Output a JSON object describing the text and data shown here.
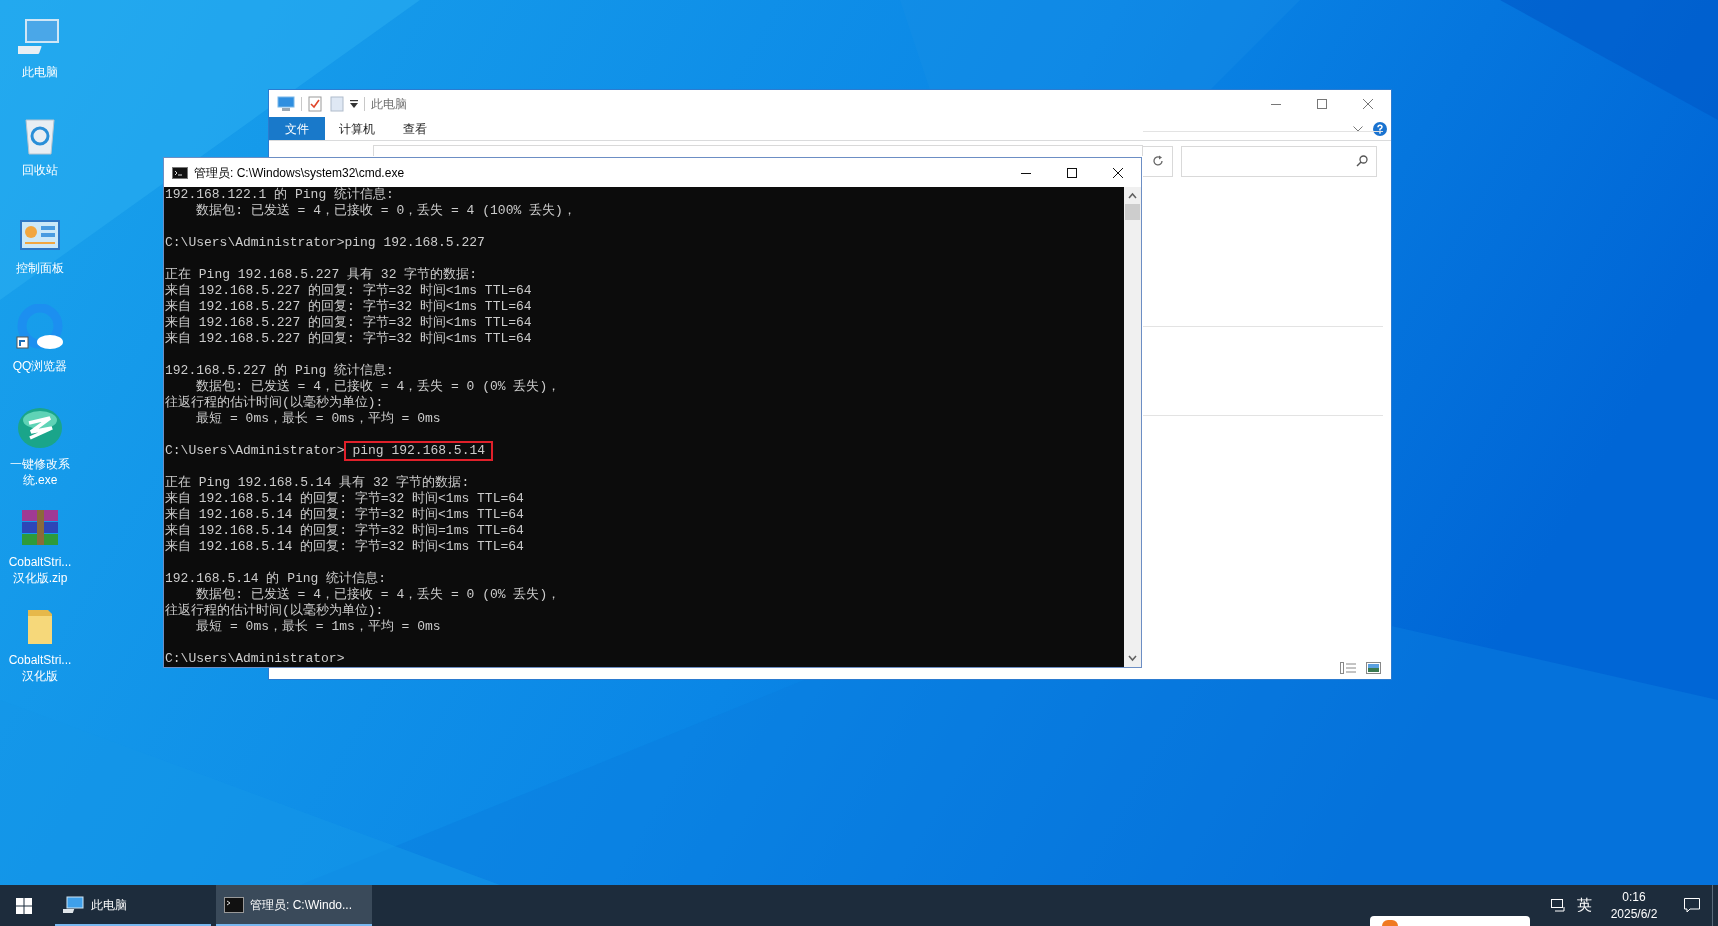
{
  "desktop_icons": [
    {
      "kind": "computer",
      "label_lines": [
        "此电脑"
      ]
    },
    {
      "kind": "recycle-bin",
      "label_lines": [
        "回收站"
      ]
    },
    {
      "kind": "control-panel",
      "label_lines": [
        "控制面板"
      ]
    },
    {
      "kind": "browser",
      "label_lines": [
        "QQ浏览器"
      ]
    },
    {
      "kind": "app",
      "label_lines": [
        "一键修改系",
        "统.exe"
      ]
    },
    {
      "kind": "archive",
      "label_lines": [
        "CobaltStri...",
        "汉化版.zip"
      ]
    },
    {
      "kind": "folder",
      "label_lines": [
        "CobaltStri...",
        "汉化版"
      ]
    }
  ],
  "explorer": {
    "title": "此电脑",
    "ribbon_tabs": [
      {
        "label": "文件",
        "selected": true
      },
      {
        "label": "计算机",
        "selected": false
      },
      {
        "label": "查看",
        "selected": false
      }
    ]
  },
  "console": {
    "title": "管理员: C:\\Windows\\system32\\cmd.exe",
    "lines": [
      {
        "kind": "output",
        "text": "192.168.122.1 的 Ping 统计信息:"
      },
      {
        "kind": "output",
        "text": "    数据包: 已发送 = 4，已接收 = 0，丢失 = 4 (100% 丢失)，"
      },
      {
        "kind": "blank"
      },
      {
        "kind": "command",
        "prompt": "C:\\Users\\Administrator>",
        "command": "ping 192.168.5.227",
        "highlighted": false
      },
      {
        "kind": "blank"
      },
      {
        "kind": "output",
        "text": "正在 Ping 192.168.5.227 具有 32 字节的数据:"
      },
      {
        "kind": "output",
        "text": "来自 192.168.5.227 的回复: 字节=32 时间<1ms TTL=64"
      },
      {
        "kind": "output",
        "text": "来自 192.168.5.227 的回复: 字节=32 时间<1ms TTL=64"
      },
      {
        "kind": "output",
        "text": "来自 192.168.5.227 的回复: 字节=32 时间<1ms TTL=64"
      },
      {
        "kind": "output",
        "text": "来自 192.168.5.227 的回复: 字节=32 时间<1ms TTL=64"
      },
      {
        "kind": "blank"
      },
      {
        "kind": "output",
        "text": "192.168.5.227 的 Ping 统计信息:"
      },
      {
        "kind": "output",
        "text": "    数据包: 已发送 = 4，已接收 = 4，丢失 = 0 (0% 丢失)，"
      },
      {
        "kind": "output",
        "text": "往返行程的估计时间(以毫秒为单位):"
      },
      {
        "kind": "output",
        "text": "    最短 = 0ms，最长 = 0ms，平均 = 0ms"
      },
      {
        "kind": "blank"
      },
      {
        "kind": "command",
        "prompt": "C:\\Users\\Administrator>",
        "command": "ping 192.168.5.14",
        "highlighted": true
      },
      {
        "kind": "blank"
      },
      {
        "kind": "output",
        "text": "正在 Ping 192.168.5.14 具有 32 字节的数据:"
      },
      {
        "kind": "output",
        "text": "来自 192.168.5.14 的回复: 字节=32 时间<1ms TTL=64"
      },
      {
        "kind": "output",
        "text": "来自 192.168.5.14 的回复: 字节=32 时间<1ms TTL=64"
      },
      {
        "kind": "output",
        "text": "来自 192.168.5.14 的回复: 字节=32 时间=1ms TTL=64"
      },
      {
        "kind": "output",
        "text": "来自 192.168.5.14 的回复: 字节=32 时间<1ms TTL=64"
      },
      {
        "kind": "blank"
      },
      {
        "kind": "output",
        "text": "192.168.5.14 的 Ping 统计信息:"
      },
      {
        "kind": "output",
        "text": "    数据包: 已发送 = 4，已接收 = 4，丢失 = 0 (0% 丢失)，"
      },
      {
        "kind": "output",
        "text": "往返行程的估计时间(以毫秒为单位):"
      },
      {
        "kind": "output",
        "text": "    最短 = 0ms，最长 = 1ms，平均 = 0ms"
      },
      {
        "kind": "blank"
      },
      {
        "kind": "command",
        "prompt": "C:\\Users\\Administrator>"
      }
    ]
  },
  "taskbar": {
    "tasks": [
      {
        "kind": "explorer",
        "label": "此电脑",
        "selected": false
      },
      {
        "kind": "console",
        "label": "管理员: C:\\Windo...",
        "selected": true
      }
    ],
    "ime": "英",
    "time": "0:16",
    "date": "2025/6/2"
  }
}
